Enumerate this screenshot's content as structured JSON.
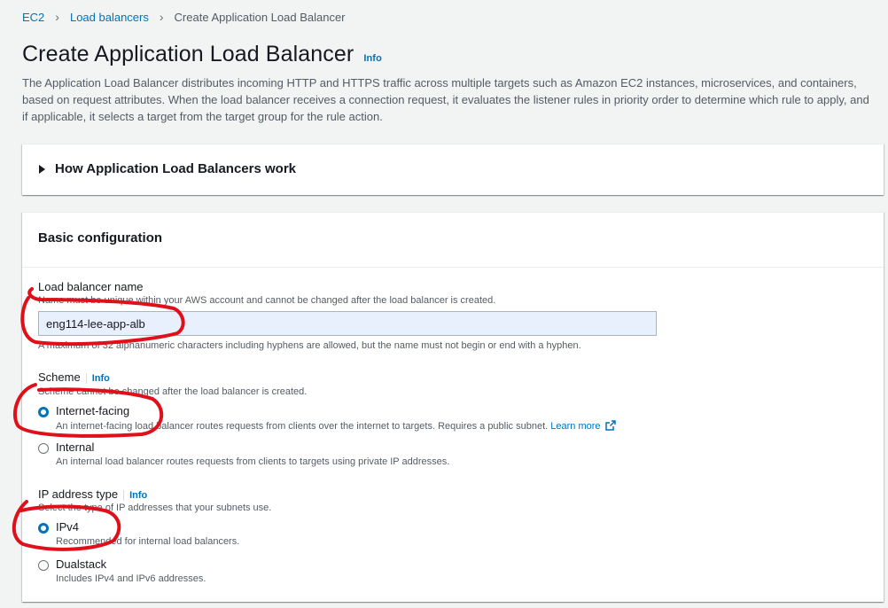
{
  "breadcrumb": {
    "items": [
      "EC2",
      "Load balancers"
    ],
    "current": "Create Application Load Balancer"
  },
  "header": {
    "title": "Create Application Load Balancer",
    "info": "Info",
    "description": "The Application Load Balancer distributes incoming HTTP and HTTPS traffic across multiple targets such as Amazon EC2 instances, microservices, and containers, based on request attributes. When the load balancer receives a connection request, it evaluates the listener rules in priority order to determine which rule to apply, and if applicable, it selects a target from the target group for the rule action."
  },
  "expander": {
    "title": "How Application Load Balancers work"
  },
  "basic_config": {
    "title": "Basic configuration",
    "name": {
      "label": "Load balancer name",
      "description": "Name must be unique within your AWS account and cannot be changed after the load balancer is created.",
      "value": "eng114-lee-app-alb",
      "constraint": "A maximum of 32 alphanumeric characters including hyphens are allowed, but the name must not begin or end with a hyphen."
    },
    "scheme": {
      "label": "Scheme",
      "info": "Info",
      "description": "Scheme cannot be changed after the load balancer is created.",
      "options": [
        {
          "label": "Internet-facing",
          "description": "An internet-facing load balancer routes requests from clients over the internet to targets. Requires a public subnet.",
          "link": "Learn more",
          "selected": true
        },
        {
          "label": "Internal",
          "description": "An internal load balancer routes requests from clients to targets using private IP addresses.",
          "selected": false
        }
      ]
    },
    "ip_type": {
      "label": "IP address type",
      "info": "Info",
      "description": "Select the type of IP addresses that your subnets use.",
      "options": [
        {
          "label": "IPv4",
          "description": "Recommended for internal load balancers.",
          "selected": true
        },
        {
          "label": "Dualstack",
          "description": "Includes IPv4 and IPv6 addresses.",
          "selected": false
        }
      ]
    }
  },
  "colors": {
    "link": "#0073bb",
    "annotation": "#e0101a",
    "background": "#f2f3f3"
  }
}
